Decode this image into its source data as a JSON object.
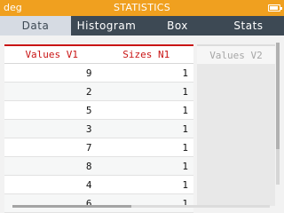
{
  "status_bar": {
    "mode": "deg",
    "title": "STATISTICS",
    "battery_icon": "battery-icon"
  },
  "tabs": [
    {
      "label": "Data",
      "active": true
    },
    {
      "label": "Histogram",
      "active": false
    },
    {
      "label": "Box",
      "active": false
    },
    {
      "label": "Stats",
      "active": false
    }
  ],
  "table": {
    "headers": [
      "Values V1",
      "Sizes N1"
    ],
    "rows": [
      {
        "value": "9",
        "size": "1"
      },
      {
        "value": "2",
        "size": "1"
      },
      {
        "value": "5",
        "size": "1"
      },
      {
        "value": "3",
        "size": "1"
      },
      {
        "value": "7",
        "size": "1"
      },
      {
        "value": "8",
        "size": "1"
      },
      {
        "value": "4",
        "size": "1"
      },
      {
        "value": "6",
        "size": "1"
      }
    ]
  },
  "next_column": {
    "header": "Values V2"
  },
  "colors": {
    "status_bar": "#f0a01f",
    "tab_bar": "#3d4954",
    "active_tab": "#d6dbe3",
    "header_accent": "#c91414",
    "background": "#f2f2f2"
  }
}
